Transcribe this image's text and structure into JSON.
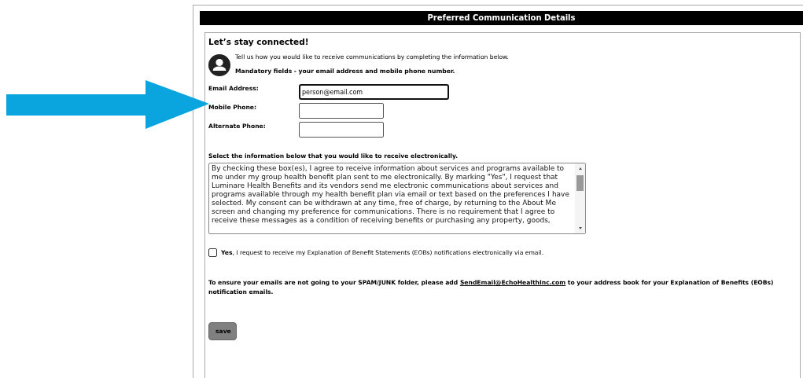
{
  "header": {
    "title": "Preferred Communication Details"
  },
  "intro": {
    "heading": "Let’s stay connected!",
    "text": "Tell us how you would like to receive communications by completing the information below.",
    "mandatory": "Mandatory fields - your email address and mobile phone number."
  },
  "fields": [
    {
      "label": "Email Address:",
      "value": "person@email.com",
      "focused": true,
      "wide": true
    },
    {
      "label": "Mobile Phone:",
      "focused": false,
      "wide": false
    },
    {
      "label": "Alternate Phone:",
      "focused": false,
      "wide": false
    }
  ],
  "consent": {
    "heading": "Select the information below that you would like to receive electronically.",
    "text": "By checking these box(es), I agree to receive information about services and programs available to me under my group health benefit plan sent to me electronically. By marking \"Yes\", I request that Luminare Health Benefits and its vendors send me electronic communications about services and programs available through my health benefit plan via email or text based on the preferences I have selected. My consent can be withdrawn at any time, free of charge, by returning to the About Me screen and changing my preference for communications. There is no requirement that I agree to receive these messages as a condition of receiving benefits or purchasing any property, goods,"
  },
  "eob_option": {
    "label": "**Yes**, I request to receive my Explanation of Benefit Statements (EOBs) notifications electronically via email.",
    "checked": false
  },
  "notice": {
    "before": "To ensure your emails are not going to your SPAM/JUNK folder, please add",
    "link": "SendEmail@EchoHealthInc.com",
    "after": "to your address book for your Explanation of Benefits (EOBs) notification emails."
  },
  "save_button": "save"
}
